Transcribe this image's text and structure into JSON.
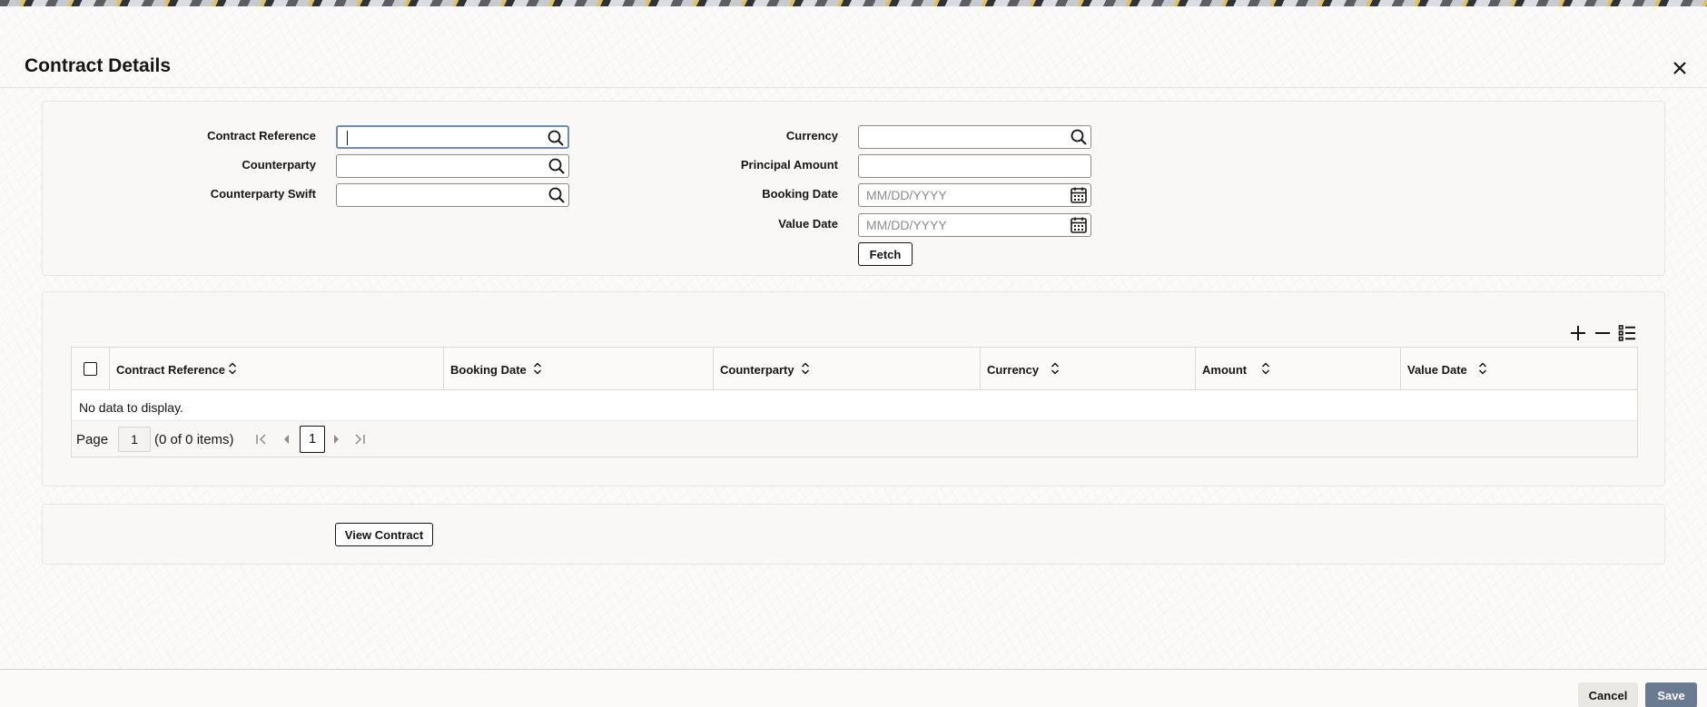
{
  "dialog": {
    "title": "Contract Details"
  },
  "search": {
    "contract_reference_label": "Contract Reference",
    "counterparty_label": "Counterparty",
    "counterparty_swift_label": "Counterparty Swift",
    "currency_label": "Currency",
    "principal_amount_label": "Principal Amount",
    "booking_date_label": "Booking Date",
    "booking_date_placeholder": "MM/DD/YYYY",
    "value_date_label": "Value Date",
    "value_date_placeholder": "MM/DD/YYYY",
    "fetch_label": "Fetch"
  },
  "grid": {
    "columns": [
      "Contract Reference",
      "Booking Date",
      "Counterparty",
      "Currency",
      "Amount",
      "Value Date"
    ],
    "empty_text": "No data to display.",
    "pager": {
      "page_label": "Page",
      "page_value": "1",
      "items_text": "(0 of 0 items)",
      "current_page": "1"
    }
  },
  "actions": {
    "view_contract_label": "View Contract"
  },
  "footer": {
    "cancel_label": "Cancel",
    "save_label": "Save"
  },
  "colors": {
    "save_button": "#697a91",
    "focus_border": "#6c8eb1"
  },
  "icons": [
    "search-icon",
    "calendar-icon",
    "close-icon",
    "add-row-icon",
    "delete-row-icon",
    "column-list-icon",
    "sort-icon",
    "first-page-icon",
    "previous-page-icon",
    "next-page-icon",
    "last-page-icon"
  ]
}
